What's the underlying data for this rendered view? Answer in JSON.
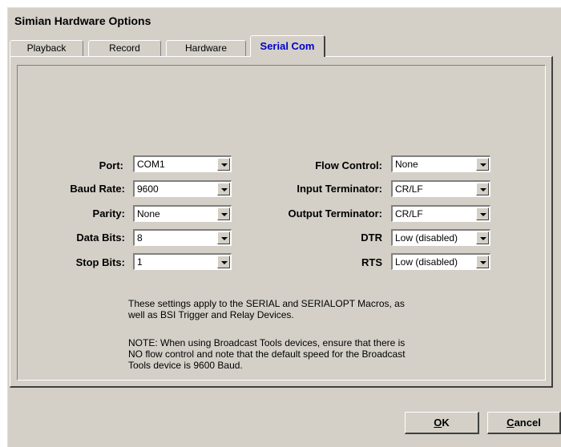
{
  "window": {
    "title": "Simian Hardware Options"
  },
  "tabs": [
    {
      "label": "Playback"
    },
    {
      "label": "Record"
    },
    {
      "label": "Hardware"
    },
    {
      "label": "Serial Com",
      "active": true
    }
  ],
  "left_fields": [
    {
      "label": "Port:",
      "value": "COM1"
    },
    {
      "label": "Baud Rate:",
      "value": "9600"
    },
    {
      "label": "Parity:",
      "value": "None"
    },
    {
      "label": "Data Bits:",
      "value": "8"
    },
    {
      "label": "Stop Bits:",
      "value": "1"
    }
  ],
  "right_fields": [
    {
      "label": "Flow Control:",
      "value": "None"
    },
    {
      "label": "Input Terminator:",
      "value": "CR/LF"
    },
    {
      "label": "Output Terminator:",
      "value": "CR/LF"
    },
    {
      "label": "DTR",
      "value": "Low (disabled)"
    },
    {
      "label": "RTS",
      "value": "Low (disabled)"
    }
  ],
  "notes": {
    "line1a": "These settings apply to the SERIAL and SERIALOPT Macros, as",
    "line1b": "well as BSI Trigger and Relay Devices.",
    "line2a": "NOTE: When using Broadcast Tools devices, ensure that there is",
    "line2b": "NO flow control and note that the default speed for the Broadcast",
    "line2c": "Tools device is 9600 Baud."
  },
  "buttons": {
    "ok_mnemonic": "O",
    "ok_rest": "K",
    "cancel_mnemonic": "C",
    "cancel_rest": "ancel"
  }
}
